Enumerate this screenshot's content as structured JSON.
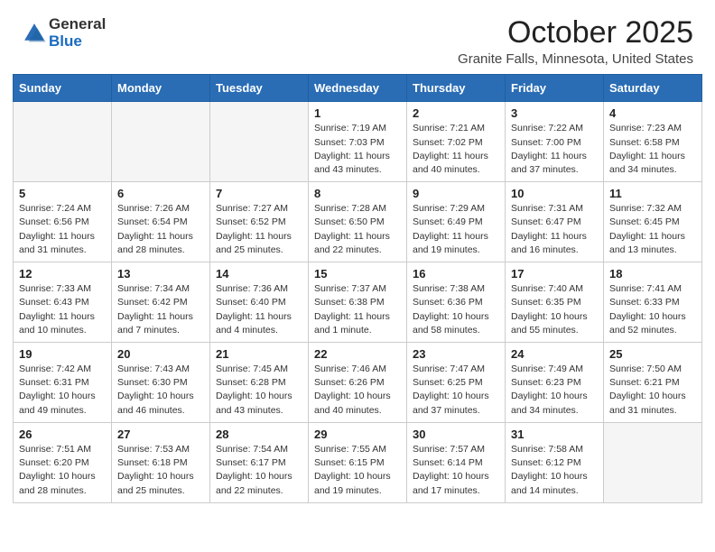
{
  "header": {
    "logo_general": "General",
    "logo_blue": "Blue",
    "month_title": "October 2025",
    "location": "Granite Falls, Minnesota, United States"
  },
  "days_of_week": [
    "Sunday",
    "Monday",
    "Tuesday",
    "Wednesday",
    "Thursday",
    "Friday",
    "Saturday"
  ],
  "weeks": [
    [
      {
        "day": "",
        "sunrise": "",
        "sunset": "",
        "daylight": ""
      },
      {
        "day": "",
        "sunrise": "",
        "sunset": "",
        "daylight": ""
      },
      {
        "day": "",
        "sunrise": "",
        "sunset": "",
        "daylight": ""
      },
      {
        "day": "1",
        "sunrise": "Sunrise: 7:19 AM",
        "sunset": "Sunset: 7:03 PM",
        "daylight": "Daylight: 11 hours and 43 minutes."
      },
      {
        "day": "2",
        "sunrise": "Sunrise: 7:21 AM",
        "sunset": "Sunset: 7:02 PM",
        "daylight": "Daylight: 11 hours and 40 minutes."
      },
      {
        "day": "3",
        "sunrise": "Sunrise: 7:22 AM",
        "sunset": "Sunset: 7:00 PM",
        "daylight": "Daylight: 11 hours and 37 minutes."
      },
      {
        "day": "4",
        "sunrise": "Sunrise: 7:23 AM",
        "sunset": "Sunset: 6:58 PM",
        "daylight": "Daylight: 11 hours and 34 minutes."
      }
    ],
    [
      {
        "day": "5",
        "sunrise": "Sunrise: 7:24 AM",
        "sunset": "Sunset: 6:56 PM",
        "daylight": "Daylight: 11 hours and 31 minutes."
      },
      {
        "day": "6",
        "sunrise": "Sunrise: 7:26 AM",
        "sunset": "Sunset: 6:54 PM",
        "daylight": "Daylight: 11 hours and 28 minutes."
      },
      {
        "day": "7",
        "sunrise": "Sunrise: 7:27 AM",
        "sunset": "Sunset: 6:52 PM",
        "daylight": "Daylight: 11 hours and 25 minutes."
      },
      {
        "day": "8",
        "sunrise": "Sunrise: 7:28 AM",
        "sunset": "Sunset: 6:50 PM",
        "daylight": "Daylight: 11 hours and 22 minutes."
      },
      {
        "day": "9",
        "sunrise": "Sunrise: 7:29 AM",
        "sunset": "Sunset: 6:49 PM",
        "daylight": "Daylight: 11 hours and 19 minutes."
      },
      {
        "day": "10",
        "sunrise": "Sunrise: 7:31 AM",
        "sunset": "Sunset: 6:47 PM",
        "daylight": "Daylight: 11 hours and 16 minutes."
      },
      {
        "day": "11",
        "sunrise": "Sunrise: 7:32 AM",
        "sunset": "Sunset: 6:45 PM",
        "daylight": "Daylight: 11 hours and 13 minutes."
      }
    ],
    [
      {
        "day": "12",
        "sunrise": "Sunrise: 7:33 AM",
        "sunset": "Sunset: 6:43 PM",
        "daylight": "Daylight: 11 hours and 10 minutes."
      },
      {
        "day": "13",
        "sunrise": "Sunrise: 7:34 AM",
        "sunset": "Sunset: 6:42 PM",
        "daylight": "Daylight: 11 hours and 7 minutes."
      },
      {
        "day": "14",
        "sunrise": "Sunrise: 7:36 AM",
        "sunset": "Sunset: 6:40 PM",
        "daylight": "Daylight: 11 hours and 4 minutes."
      },
      {
        "day": "15",
        "sunrise": "Sunrise: 7:37 AM",
        "sunset": "Sunset: 6:38 PM",
        "daylight": "Daylight: 11 hours and 1 minute."
      },
      {
        "day": "16",
        "sunrise": "Sunrise: 7:38 AM",
        "sunset": "Sunset: 6:36 PM",
        "daylight": "Daylight: 10 hours and 58 minutes."
      },
      {
        "day": "17",
        "sunrise": "Sunrise: 7:40 AM",
        "sunset": "Sunset: 6:35 PM",
        "daylight": "Daylight: 10 hours and 55 minutes."
      },
      {
        "day": "18",
        "sunrise": "Sunrise: 7:41 AM",
        "sunset": "Sunset: 6:33 PM",
        "daylight": "Daylight: 10 hours and 52 minutes."
      }
    ],
    [
      {
        "day": "19",
        "sunrise": "Sunrise: 7:42 AM",
        "sunset": "Sunset: 6:31 PM",
        "daylight": "Daylight: 10 hours and 49 minutes."
      },
      {
        "day": "20",
        "sunrise": "Sunrise: 7:43 AM",
        "sunset": "Sunset: 6:30 PM",
        "daylight": "Daylight: 10 hours and 46 minutes."
      },
      {
        "day": "21",
        "sunrise": "Sunrise: 7:45 AM",
        "sunset": "Sunset: 6:28 PM",
        "daylight": "Daylight: 10 hours and 43 minutes."
      },
      {
        "day": "22",
        "sunrise": "Sunrise: 7:46 AM",
        "sunset": "Sunset: 6:26 PM",
        "daylight": "Daylight: 10 hours and 40 minutes."
      },
      {
        "day": "23",
        "sunrise": "Sunrise: 7:47 AM",
        "sunset": "Sunset: 6:25 PM",
        "daylight": "Daylight: 10 hours and 37 minutes."
      },
      {
        "day": "24",
        "sunrise": "Sunrise: 7:49 AM",
        "sunset": "Sunset: 6:23 PM",
        "daylight": "Daylight: 10 hours and 34 minutes."
      },
      {
        "day": "25",
        "sunrise": "Sunrise: 7:50 AM",
        "sunset": "Sunset: 6:21 PM",
        "daylight": "Daylight: 10 hours and 31 minutes."
      }
    ],
    [
      {
        "day": "26",
        "sunrise": "Sunrise: 7:51 AM",
        "sunset": "Sunset: 6:20 PM",
        "daylight": "Daylight: 10 hours and 28 minutes."
      },
      {
        "day": "27",
        "sunrise": "Sunrise: 7:53 AM",
        "sunset": "Sunset: 6:18 PM",
        "daylight": "Daylight: 10 hours and 25 minutes."
      },
      {
        "day": "28",
        "sunrise": "Sunrise: 7:54 AM",
        "sunset": "Sunset: 6:17 PM",
        "daylight": "Daylight: 10 hours and 22 minutes."
      },
      {
        "day": "29",
        "sunrise": "Sunrise: 7:55 AM",
        "sunset": "Sunset: 6:15 PM",
        "daylight": "Daylight: 10 hours and 19 minutes."
      },
      {
        "day": "30",
        "sunrise": "Sunrise: 7:57 AM",
        "sunset": "Sunset: 6:14 PM",
        "daylight": "Daylight: 10 hours and 17 minutes."
      },
      {
        "day": "31",
        "sunrise": "Sunrise: 7:58 AM",
        "sunset": "Sunset: 6:12 PM",
        "daylight": "Daylight: 10 hours and 14 minutes."
      },
      {
        "day": "",
        "sunrise": "",
        "sunset": "",
        "daylight": ""
      }
    ]
  ]
}
